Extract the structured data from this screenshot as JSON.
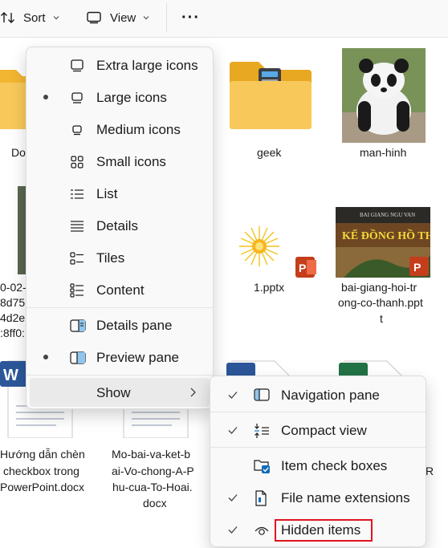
{
  "toolbar": {
    "sort_label": "Sort",
    "view_label": "View",
    "more_label": "···"
  },
  "files": {
    "left_partial_1": "Do",
    "geek": "geek",
    "man_hinh": "man-hinh",
    "pptx_1": "1.pptx",
    "bai_giang": [
      "bai-giang-hoi-tr",
      "ong-co-thanh.ppt",
      "t"
    ],
    "left_partial_2": [
      "0-02-",
      "8d75(",
      "4d2e(",
      ":8ff0:"
    ],
    "huong_dan": [
      "Hướng dẫn chèn",
      "checkbox trong",
      "PowerPoint.docx"
    ],
    "mo_bai": [
      "Mo-bai-va-ket-b",
      "ai-Vo-chong-A-P",
      "hu-cua-To-Hoai.",
      "docx"
    ],
    "right_partial": "R"
  },
  "view_menu": {
    "items": [
      {
        "label": "Extra large icons",
        "icon": "monitor-icon",
        "selected": false
      },
      {
        "label": "Large icons",
        "icon": "monitor-icon",
        "selected": true
      },
      {
        "label": "Medium icons",
        "icon": "monitor-icon",
        "selected": false
      },
      {
        "label": "Small icons",
        "icon": "grid-icon",
        "selected": false
      },
      {
        "label": "List",
        "icon": "list-icon",
        "selected": false
      },
      {
        "label": "Details",
        "icon": "details-icon",
        "selected": false
      },
      {
        "label": "Tiles",
        "icon": "tiles-icon",
        "selected": false
      },
      {
        "label": "Content",
        "icon": "content-icon",
        "selected": false
      },
      {
        "label": "Details pane",
        "icon": "details-pane-icon",
        "selected": false
      },
      {
        "label": "Preview pane",
        "icon": "preview-pane-icon",
        "selected": true
      },
      {
        "label": "Show",
        "icon": "",
        "selected": false
      }
    ]
  },
  "show_submenu": {
    "items": [
      {
        "label": "Navigation pane",
        "icon": "navigation-pane-icon",
        "checked": true
      },
      {
        "label": "Compact view",
        "icon": "compact-view-icon",
        "checked": true
      },
      {
        "label": "Item check boxes",
        "icon": "checkbox-folder-icon",
        "checked": false
      },
      {
        "label": "File name extensions",
        "icon": "file-extension-icon",
        "checked": true
      },
      {
        "label": "Hidden items",
        "icon": "eye-icon",
        "checked": true
      }
    ]
  },
  "colors": {
    "highlight": "#e0141e",
    "accent": "#0f6cbd",
    "folder": "#f8c95a"
  }
}
